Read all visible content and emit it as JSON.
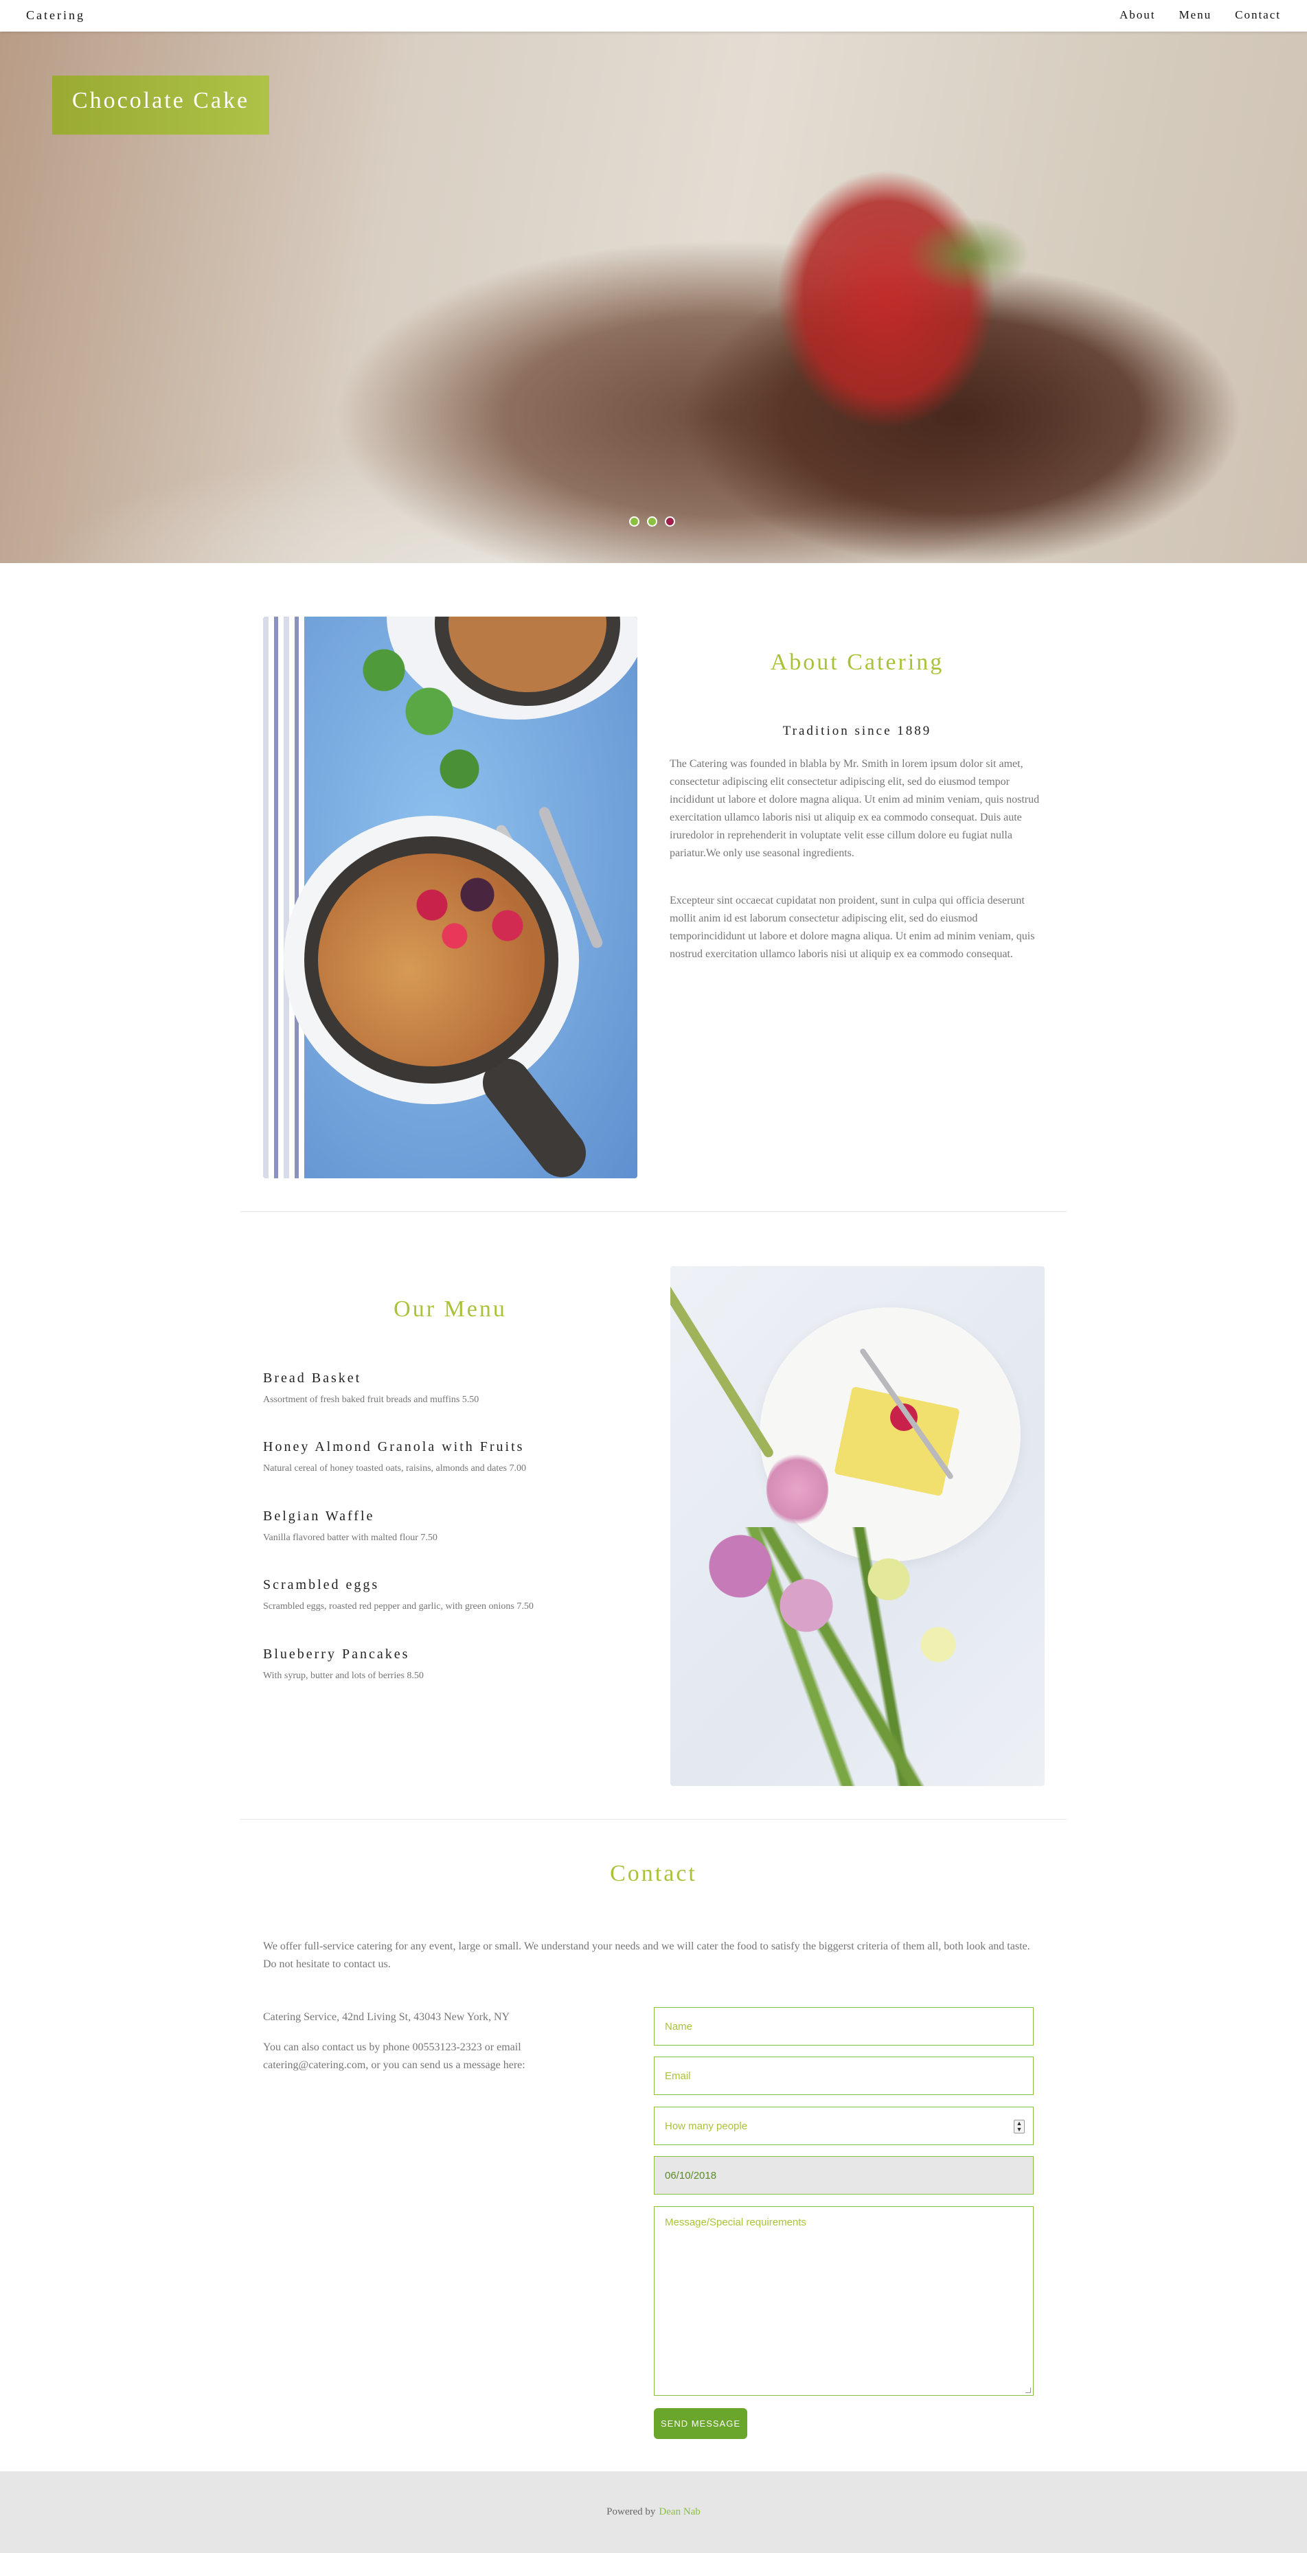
{
  "nav": {
    "brand": "Catering",
    "links": [
      "About",
      "Menu",
      "Contact"
    ]
  },
  "hero": {
    "title": "Chocolate Cake",
    "slides_total": 3,
    "active_slide": 3
  },
  "about": {
    "title": "About Catering",
    "subtitle": "Tradition since 1889",
    "paragraph1": "The Catering was founded in blabla by Mr. Smith in lorem ipsum dolor sit amet, consectetur adipiscing elit consectetur adipiscing elit, sed do eiusmod tempor incididunt ut labore et dolore magna aliqua. Ut enim ad minim veniam, quis nostrud exercitation ullamco laboris nisi ut aliquip ex ea commodo consequat. Duis aute iruredolor in reprehenderit in voluptate velit esse cillum dolore eu fugiat nulla pariatur.We only use seasonal ingredients.",
    "paragraph2": "Excepteur sint occaecat cupidatat non proident, sunt in culpa qui officia deserunt mollit anim id est laborum consectetur adipiscing elit, sed do eiusmod temporincididunt ut labore et dolore magna aliqua. Ut enim ad minim veniam, quis nostrud exercitation ullamco laboris nisi ut aliquip ex ea commodo consequat."
  },
  "menu": {
    "title": "Our Menu",
    "items": [
      {
        "name": "Bread Basket",
        "desc": "Assortment of fresh baked fruit breads and muffins 5.50"
      },
      {
        "name": "Honey Almond Granola with Fruits",
        "desc": "Natural cereal of honey toasted oats, raisins, almonds and dates 7.00"
      },
      {
        "name": "Belgian Waffle",
        "desc": "Vanilla flavored batter with malted flour 7.50"
      },
      {
        "name": "Scrambled eggs",
        "desc": "Scrambled eggs, roasted red pepper and garlic, with green onions 7.50"
      },
      {
        "name": "Blueberry Pancakes",
        "desc": "With syrup, butter and lots of berries 8.50"
      }
    ]
  },
  "contact": {
    "title": "Contact",
    "intro": "We offer full-service catering for any event, large or small. We understand your needs and we will cater the food to satisfy the biggerst criteria of them all, both look and taste. Do not hesitate to contact us.",
    "address": "Catering Service, 42nd Living St, 43043 New York, NY",
    "more": "You can also contact us by phone 00553123-2323 or email catering@catering.com, or you can send us a message here:",
    "form": {
      "name_placeholder": "Name",
      "email_placeholder": "Email",
      "people_placeholder": "How many people",
      "date_value": "06/10/2018",
      "message_placeholder": "Message/Special requirements",
      "send_label": "SEND MESSAGE"
    }
  },
  "footer": {
    "prefix": "Powered by",
    "link": "Dean Nab"
  },
  "colors": {
    "accent": "#a8c33a",
    "button": "#6aa52c",
    "footer_bg": "#e6e6e6"
  }
}
